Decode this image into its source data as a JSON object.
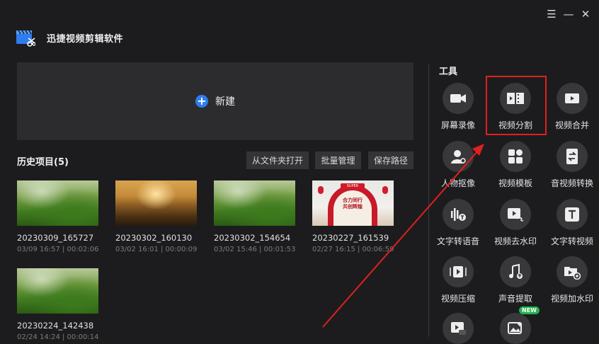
{
  "window": {
    "menu_icon": "menu-icon",
    "minimize_icon": "minimize-icon",
    "close_icon": "close-icon",
    "menu_glyph": "☰",
    "minimize_glyph": "—",
    "close_glyph": "✕"
  },
  "app": {
    "title": "迅捷视频剪辑软件",
    "logo_icon": "clapperboard-scissors-icon"
  },
  "new_project": {
    "label": "新建",
    "plus_glyph": "+"
  },
  "history": {
    "title": "历史项目(5)",
    "buttons": [
      "从文件夹打开",
      "批量管理",
      "保存路径"
    ],
    "projects": [
      {
        "name": "20230309_165727",
        "meta": "03/09 16:57 | 00:02:06",
        "thumb": "grass"
      },
      {
        "name": "20230302_160130",
        "meta": "03/02 16:01 | 00:00:09",
        "thumb": "sunset"
      },
      {
        "name": "20230302_154654",
        "meta": "03/02 15:46 | 00:01:53",
        "thumb": "grass"
      },
      {
        "name": "20230227_161539",
        "meta": "02/27 16:15 | 00:06:59",
        "thumb": "redposter"
      },
      {
        "name": "20230224_142438",
        "meta": "02/24 14:24 | 00:00:14",
        "thumb": "grass"
      }
    ]
  },
  "poster": {
    "top_tag": "SUPER",
    "text": "合力同行 共创辉煌"
  },
  "tools": {
    "title": "工具",
    "new_badge": "NEW",
    "items": [
      {
        "label": "屏幕录像",
        "icon": "camera-icon"
      },
      {
        "label": "视频分割",
        "icon": "film-split-icon"
      },
      {
        "label": "视频合并",
        "icon": "video-merge-icon"
      },
      {
        "label": "人物抠像",
        "icon": "person-cutout-icon"
      },
      {
        "label": "视频模板",
        "icon": "template-icon"
      },
      {
        "label": "音视频转换",
        "icon": "convert-icon"
      },
      {
        "label": "文字转语音",
        "icon": "text-to-speech-icon"
      },
      {
        "label": "视频去水印",
        "icon": "remove-watermark-icon"
      },
      {
        "label": "文字转视频",
        "icon": "text-to-video-icon"
      },
      {
        "label": "视频压缩",
        "icon": "compress-icon"
      },
      {
        "label": "声音提取",
        "icon": "audio-extract-icon"
      },
      {
        "label": "视频加水印",
        "icon": "add-watermark-icon"
      },
      {
        "label": "",
        "icon": "gif-icon"
      },
      {
        "label": "",
        "icon": "image-new-icon"
      }
    ]
  },
  "colors": {
    "accent_blue": "#2f7cf0",
    "highlight_red": "#e0201e",
    "new_badge_green": "#23b14d",
    "background": "#1c1c1e"
  }
}
